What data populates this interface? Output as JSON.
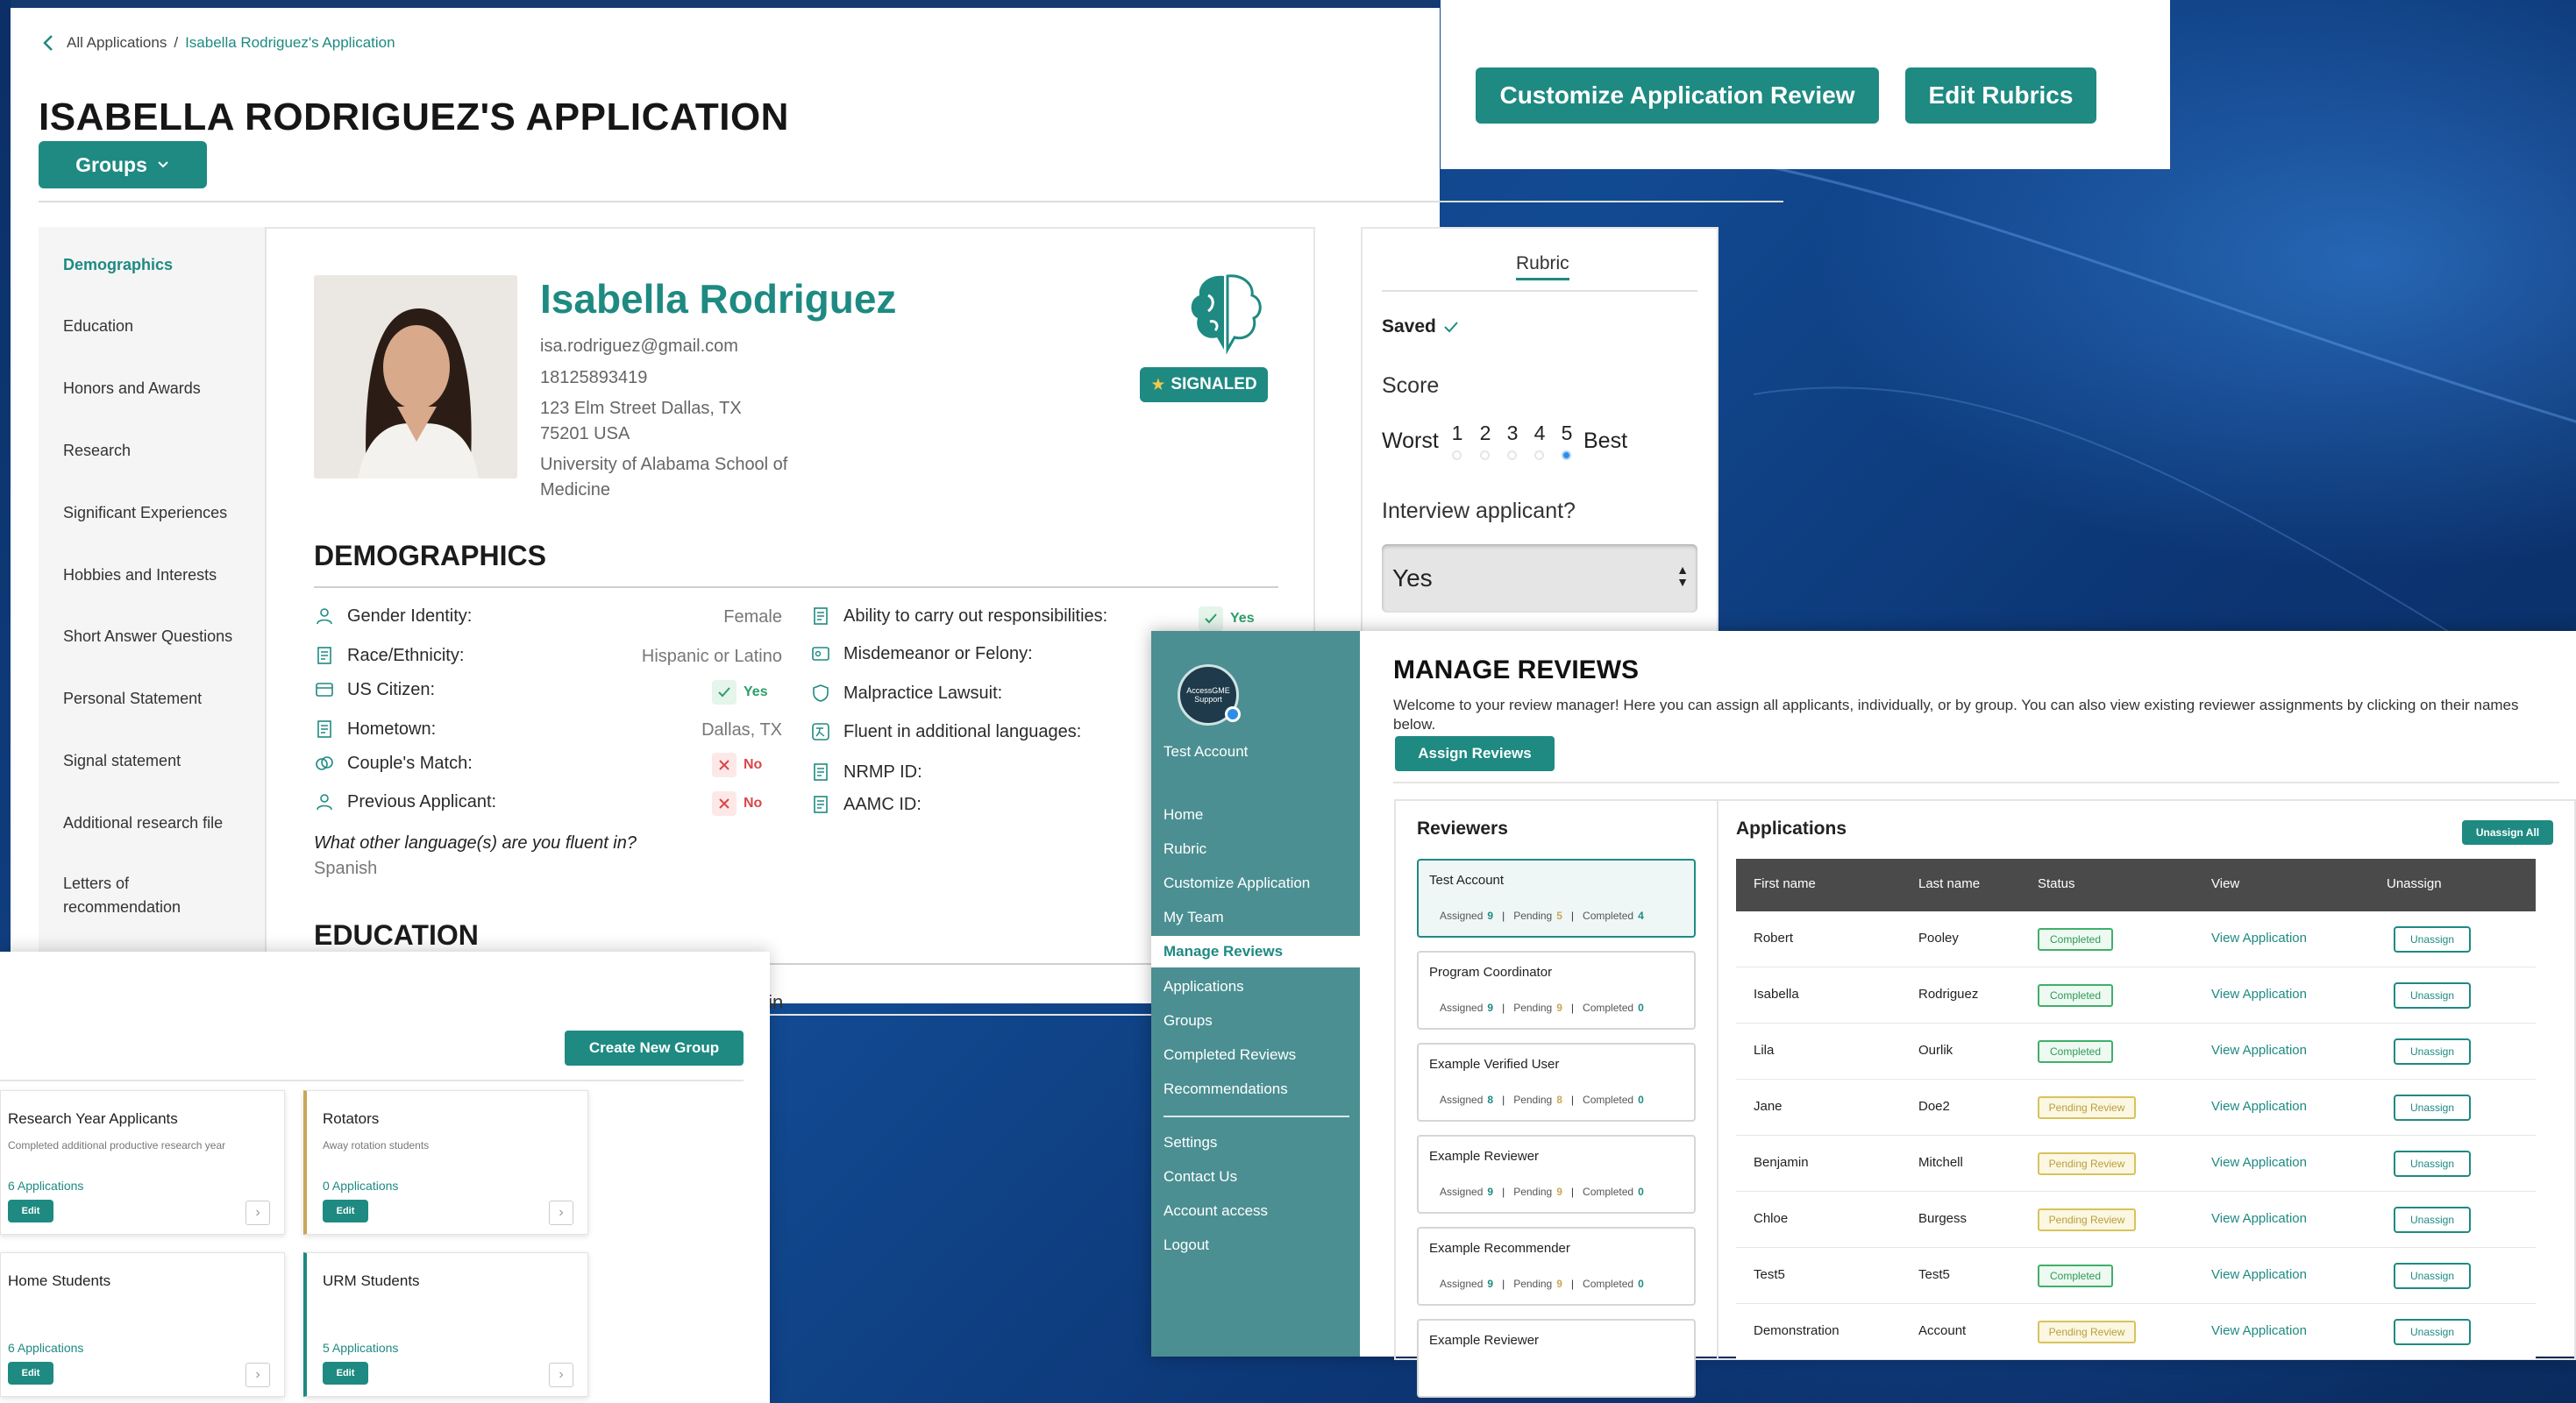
{
  "header": {
    "breadcrumb_root": "All Applications",
    "breadcrumb_sep": "/",
    "breadcrumb_current": "Isabella Rodriguez's Application",
    "title": "ISABELLA RODRIGUEZ'S APPLICATION",
    "groups_label": "Groups",
    "customize_label": "Customize Application Review",
    "edit_rubrics_label": "Edit Rubrics"
  },
  "sidebar": {
    "items": [
      {
        "label": "Demographics"
      },
      {
        "label": "Education"
      },
      {
        "label": "Honors and Awards"
      },
      {
        "label": "Research"
      },
      {
        "label": "Significant Experiences"
      },
      {
        "label": "Hobbies and Interests"
      },
      {
        "label": "Short Answer Questions"
      },
      {
        "label": "Personal Statement"
      },
      {
        "label": "Signal statement"
      },
      {
        "label": "Additional research file"
      },
      {
        "label": "Letters of"
      },
      {
        "label": "recommendation"
      }
    ]
  },
  "applicant": {
    "name": "Isabella Rodriguez",
    "email": "isa.rodriguez@gmail.com",
    "phone": "18125893419",
    "address1": "123 Elm Street Dallas, TX",
    "address2": "75201 USA",
    "school1": "University of Alabama School of",
    "school2": "Medicine",
    "badge": "SIGNALED"
  },
  "demographics": {
    "title": "DEMOGRAPHICS",
    "left": [
      {
        "label": "Gender Identity:",
        "value": "Female"
      },
      {
        "label": "Race/Ethnicity:",
        "value": "Hispanic or Latino"
      },
      {
        "label": "US Citizen:",
        "value": "Yes"
      },
      {
        "label": "Hometown:",
        "value": "Dallas, TX"
      },
      {
        "label": "Couple's Match:",
        "value": "No"
      },
      {
        "label": "Previous Applicant:",
        "value": "No"
      }
    ],
    "right": [
      {
        "label": "Ability to carry out responsibilities:",
        "value": "Yes"
      },
      {
        "label": "Misdemeanor or Felony:"
      },
      {
        "label": "Malpractice Lawsuit:"
      },
      {
        "label": "Fluent in additional languages:"
      },
      {
        "label": "NRMP ID:"
      },
      {
        "label": "AAMC ID:"
      }
    ],
    "language_q": "What other language(s) are you fluent in?",
    "language_a": "Spanish"
  },
  "education": {
    "title": "EDUCATION",
    "partial": "tin"
  },
  "rubric": {
    "tab": "Rubric",
    "saved": "Saved",
    "score_label": "Score",
    "worst": "Worst",
    "best": "Best",
    "scale": [
      "1",
      "2",
      "3",
      "4",
      "5"
    ],
    "selected": 5,
    "interview_q": "Interview applicant?",
    "interview_value": "Yes"
  },
  "groups": {
    "create_label": "Create New Group",
    "cards": [
      {
        "name": "Research Year Applicants",
        "desc": "Completed additional productive research year",
        "count": "6 Applications",
        "edit": "Edit"
      },
      {
        "name": "Rotators",
        "desc": "Away rotation students",
        "count": "0 Applications",
        "edit": "Edit"
      },
      {
        "name": "Home Students",
        "desc": "",
        "count": "6 Applications",
        "edit": "Edit"
      },
      {
        "name": "URM Students",
        "desc": "",
        "count": "5 Applications",
        "edit": "Edit"
      }
    ]
  },
  "reviews": {
    "logo_text": "AccessGME Support",
    "account": "Test Account",
    "nav": [
      {
        "label": "Home"
      },
      {
        "label": "Rubric"
      },
      {
        "label": "Customize Application"
      },
      {
        "label": "My Team"
      },
      {
        "label": "Manage Reviews"
      },
      {
        "label": "Applications"
      },
      {
        "label": "Groups"
      },
      {
        "label": "Completed Reviews"
      },
      {
        "label": "Recommendations"
      }
    ],
    "nav2": [
      {
        "label": "Settings"
      },
      {
        "label": "Contact Us"
      },
      {
        "label": "Account access"
      },
      {
        "label": "Logout"
      }
    ],
    "title": "MANAGE REVIEWS",
    "welcome": "Welcome to your review manager! Here you can assign all applicants, individually, or by group. You can also view existing reviewer assignments by clicking on their names below.",
    "assign_label": "Assign Reviews",
    "reviewers_title": "Reviewers",
    "applications_title": "Applications",
    "unassign_all": "Unassign All",
    "stat_labels": {
      "assigned": "Assigned",
      "pending": "Pending",
      "completed": "Completed",
      "sep": "|"
    },
    "reviewers": [
      {
        "name": "Test Account",
        "assigned": "9",
        "pending": "5",
        "completed": "4"
      },
      {
        "name": "Program Coordinator",
        "assigned": "9",
        "pending": "9",
        "completed": "0"
      },
      {
        "name": "Example Verified User",
        "assigned": "8",
        "pending": "8",
        "completed": "0"
      },
      {
        "name": "Example Reviewer",
        "assigned": "9",
        "pending": "9",
        "completed": "0"
      },
      {
        "name": "Example Recommender",
        "assigned": "9",
        "pending": "9",
        "completed": "0"
      },
      {
        "name": "Example Reviewer"
      }
    ],
    "columns": [
      "First name",
      "Last name",
      "Status",
      "View",
      "Unassign"
    ],
    "rows": [
      {
        "first": "Robert",
        "last": "Pooley",
        "status": "Completed",
        "view": "View Application",
        "unassign": "Unassign"
      },
      {
        "first": "Isabella",
        "last": "Rodriguez",
        "status": "Completed",
        "view": "View Application",
        "unassign": "Unassign"
      },
      {
        "first": "Lila",
        "last": "Ourlik",
        "status": "Completed",
        "view": "View Application",
        "unassign": "Unassign"
      },
      {
        "first": "Jane",
        "last": "Doe2",
        "status": "Pending Review",
        "view": "View Application",
        "unassign": "Unassign"
      },
      {
        "first": "Benjamin",
        "last": "Mitchell",
        "status": "Pending Review",
        "view": "View Application",
        "unassign": "Unassign"
      },
      {
        "first": "Chloe",
        "last": "Burgess",
        "status": "Pending Review",
        "view": "View Application",
        "unassign": "Unassign"
      },
      {
        "first": "Test5",
        "last": "Test5",
        "status": "Completed",
        "view": "View Application",
        "unassign": "Unassign"
      },
      {
        "first": "Demonstration",
        "last": "Account",
        "status": "Pending Review",
        "view": "View Application",
        "unassign": "Unassign"
      }
    ]
  },
  "colors": {
    "accent": "#1e8a82",
    "sidebar": "#4b8f92",
    "background": "#0e3a78"
  }
}
